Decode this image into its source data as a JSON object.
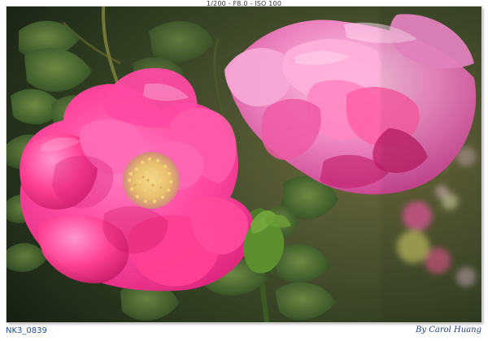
{
  "exif": "1/200 - F8.0 - ISO 100",
  "file_id": "NK3_0839",
  "credit": "By Carol Huang",
  "photo": {
    "subject": "roses",
    "colors": {
      "rose_pink": "#ff3f92",
      "rose_mauve": "#ea5fae",
      "rose_deep": "#c21d67",
      "foliage": "#3f5b2a",
      "background_dark": "#1f2a16",
      "stamen": "#f2cf6a"
    }
  }
}
